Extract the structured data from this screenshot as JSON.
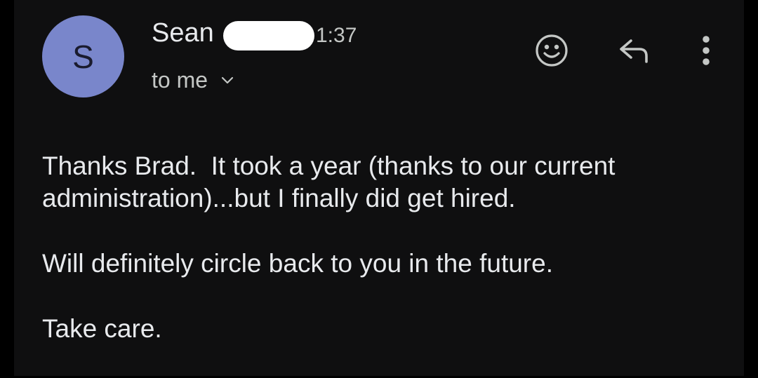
{
  "message": {
    "avatar_letter": "S",
    "avatar_color": "#7986cb",
    "sender_name": "Sean",
    "time": "1:37",
    "recipient_label": "to me",
    "body": {
      "line1": "Thanks Brad.  It took a year (thanks to our current",
      "line2": "administration)...but I finally did get hired.",
      "line3": "Will definitely circle back to you in the future.",
      "line4": "Take care."
    }
  },
  "actions": {
    "react_icon": "smiley-face-icon",
    "reply_icon": "reply-arrow-icon",
    "more_icon": "more-vertical-icon"
  },
  "colors": {
    "background": "#0f0f10",
    "text_primary": "#e8eaed",
    "text_secondary": "#c4c7c5"
  }
}
